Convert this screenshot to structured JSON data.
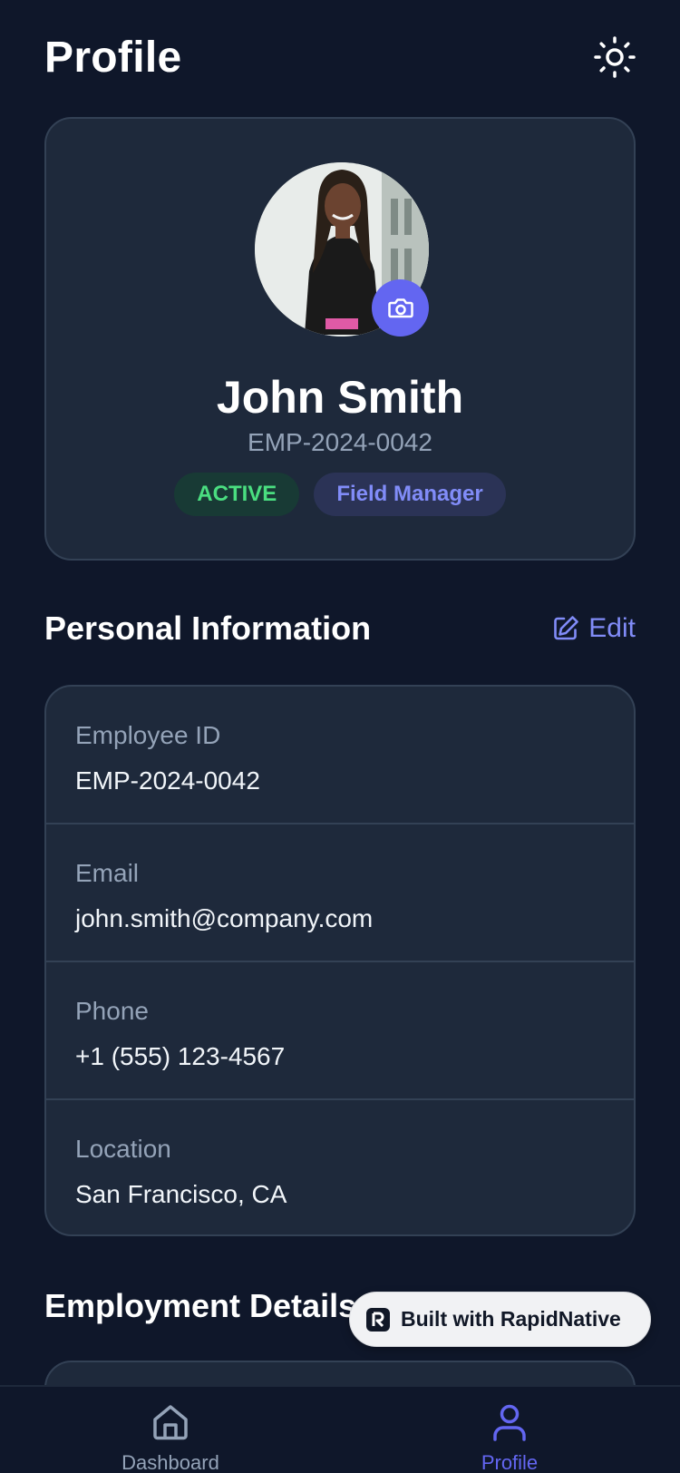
{
  "header": {
    "title": "Profile",
    "theme_icon": "sun-icon"
  },
  "profile": {
    "name": "John Smith",
    "employee_id": "EMP-2024-0042",
    "status_badge": "ACTIVE",
    "role_badge": "Field Manager",
    "camera_icon": "camera-icon"
  },
  "personal_information": {
    "title": "Personal Information",
    "edit_label": "Edit",
    "rows": [
      {
        "label": "Employee ID",
        "value": "EMP-2024-0042"
      },
      {
        "label": "Email",
        "value": "john.smith@company.com"
      },
      {
        "label": "Phone",
        "value": "+1 (555) 123-4567"
      },
      {
        "label": "Location",
        "value": "San Francisco, CA"
      }
    ]
  },
  "employment_details": {
    "title": "Employment Details"
  },
  "built_badge": {
    "label": "Built with RapidNative"
  },
  "bottom_nav": {
    "items": [
      {
        "label": "Dashboard",
        "icon": "home-icon",
        "active": false
      },
      {
        "label": "Profile",
        "icon": "user-icon",
        "active": true
      }
    ]
  },
  "colors": {
    "background": "#0f172a",
    "card": "#1e293b",
    "accent": "#6366f1",
    "active_green": "#4ade80",
    "muted_text": "#94a3b8"
  }
}
